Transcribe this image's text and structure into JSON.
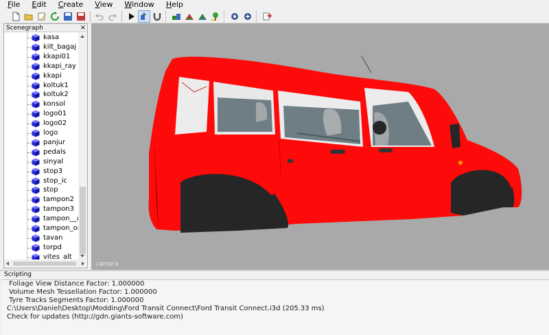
{
  "menu": [
    "File",
    "Edit",
    "Create",
    "View",
    "Window",
    "Help"
  ],
  "toolbar": {
    "buttons": [
      "new-file-icon",
      "open-folder-icon",
      "edit-icon",
      "reload-icon",
      "save-icon",
      "save-as-icon",
      "undo-icon",
      "redo-icon",
      "play-icon",
      "select-mode-icon",
      "magnet-icon",
      "add-shape-icon",
      "add-light-icon",
      "add-camera-icon",
      "add-tree-icon",
      "render-settings-icon",
      "material-settings-icon",
      "export-icon"
    ]
  },
  "scenegraph": {
    "title": "Scenegraph",
    "close_label": "×",
    "items": [
      "kasa",
      "kilt_bagaj",
      "kkapi01",
      "kkapi_ray",
      "kkapi",
      "koltuk1",
      "koltuk2",
      "konsol",
      "logo01",
      "logo02",
      "logo",
      "panjur",
      "pedals",
      "sinyal",
      "stop3",
      "stop_ic",
      "stop",
      "tampon2",
      "tampon3",
      "tampon__al",
      "tampon_on",
      "tavan",
      "torpd",
      "vites_alt"
    ]
  },
  "viewport": {
    "camera_label": "camera",
    "colors": {
      "background": "#a9a9a9",
      "body": "#ff0a0a",
      "tires": "#262626",
      "glass": "#ececec"
    }
  },
  "scripting": {
    "title": "Scripting",
    "lines": [
      "Foliage View Distance Factor: 1.000000",
      "Volume Mesh Tessellation Factor: 1.000000",
      "Tyre Tracks Segments Factor: 1.000000",
      "C:\\Users\\Daniel\\Desktop\\Modding\\Ford Transit Connect\\Ford Transit Connect.i3d (205.33 ms)",
      "Check for updates (http://gdn.giants-software.com)"
    ]
  }
}
